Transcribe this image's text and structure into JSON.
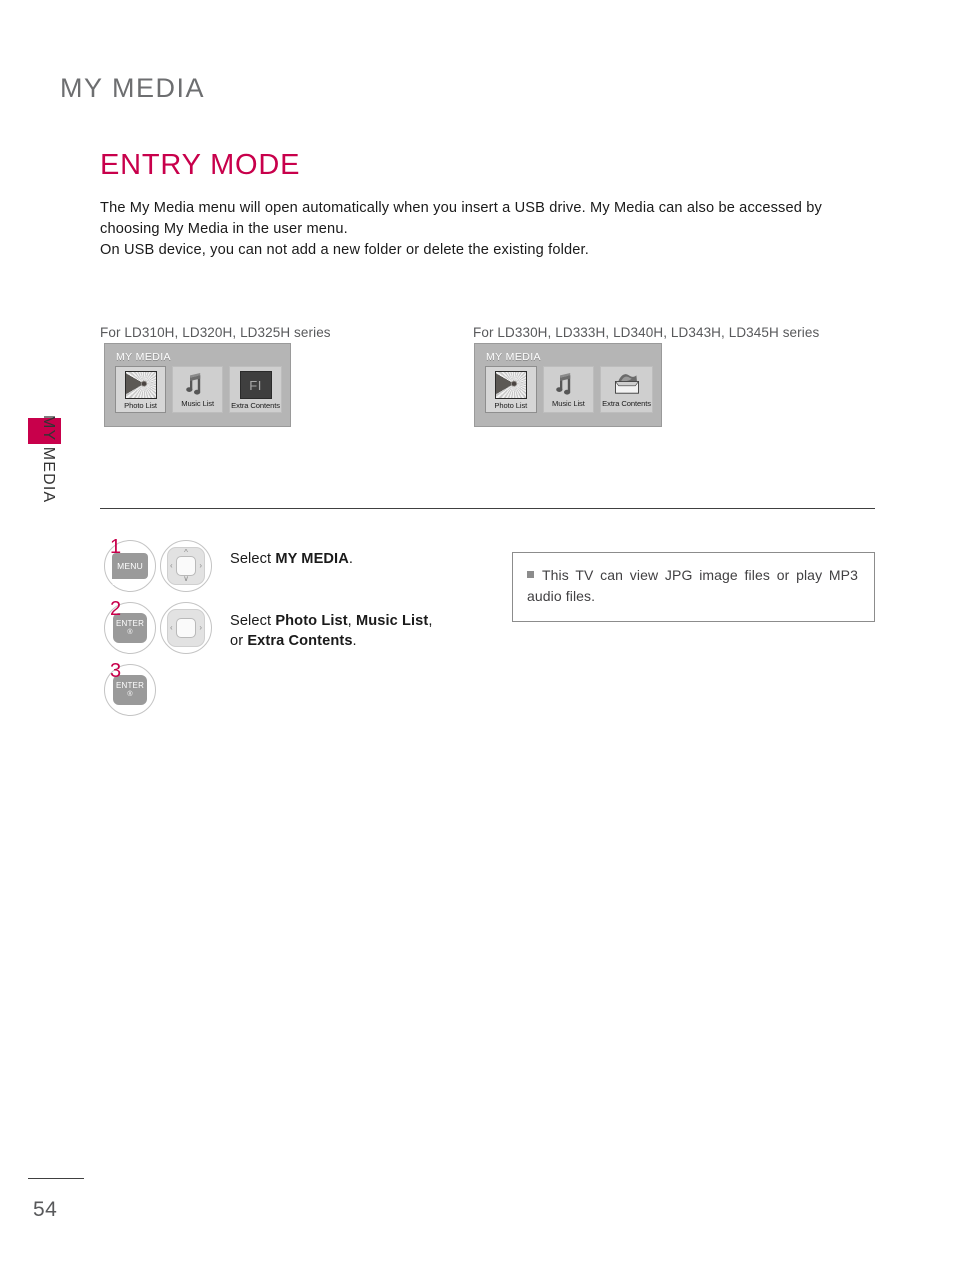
{
  "sidebar": {
    "tab_label": "MY MEDIA",
    "marker_color": "#c8004b"
  },
  "header": {
    "chapter_title": "MY MEDIA",
    "page_title": "ENTRY MODE",
    "page_title_color": "#c8004b"
  },
  "intro": {
    "line1": "The My Media menu will open automatically when you insert a USB drive. My Media can also be accessed by choosing My Media in the user menu.",
    "line2": "On USB device, you can not add a new folder or delete the existing folder."
  },
  "panels": [
    {
      "caption": "For LD310H, LD320H, LD325H series",
      "osd_title": "MY MEDIA",
      "items": [
        {
          "label": "Photo List",
          "icon": "photo-flower-icon",
          "selected": true
        },
        {
          "label": "Music List",
          "icon": "music-note-icon",
          "selected": false
        },
        {
          "label": "Extra Contents",
          "icon": "fi-block-icon",
          "glyph": "FI",
          "selected": false
        }
      ]
    },
    {
      "caption": "For LD330H, LD333H, LD340H, LD343H, LD345H series",
      "osd_title": "MY MEDIA",
      "items": [
        {
          "label": "Photo List",
          "icon": "photo-flower-icon",
          "selected": true
        },
        {
          "label": "Music List",
          "icon": "music-note-icon",
          "selected": false
        },
        {
          "label": "Extra Contents",
          "icon": "open-box-icon",
          "selected": false
        }
      ]
    }
  ],
  "steps": [
    {
      "number": "1",
      "key_label": "MENU",
      "key_type": "menu",
      "navpad": "four-way",
      "text_prefix": "Select ",
      "text_bold": "MY MEDIA",
      "text_suffix": "."
    },
    {
      "number": "2",
      "key_label": "ENTER",
      "key_sub": "®",
      "key_type": "enter",
      "navpad": "left-right",
      "text_prefix": "Select ",
      "bold_a": "Photo List",
      "sep_a": ", ",
      "bold_b": "Music List",
      "sep_b": ",",
      "text_line2_prefix": "or ",
      "bold_c": "Extra Contents",
      "text_suffix": "."
    },
    {
      "number": "3",
      "key_label": "ENTER",
      "key_sub": "®",
      "key_type": "enter",
      "navpad": "none",
      "text_prefix": "",
      "text_suffix": ""
    }
  ],
  "note": {
    "bullet": "square-bullet",
    "text": "This TV can view JPG image files or play MP3 audio files."
  },
  "footer": {
    "page_number": "54"
  }
}
